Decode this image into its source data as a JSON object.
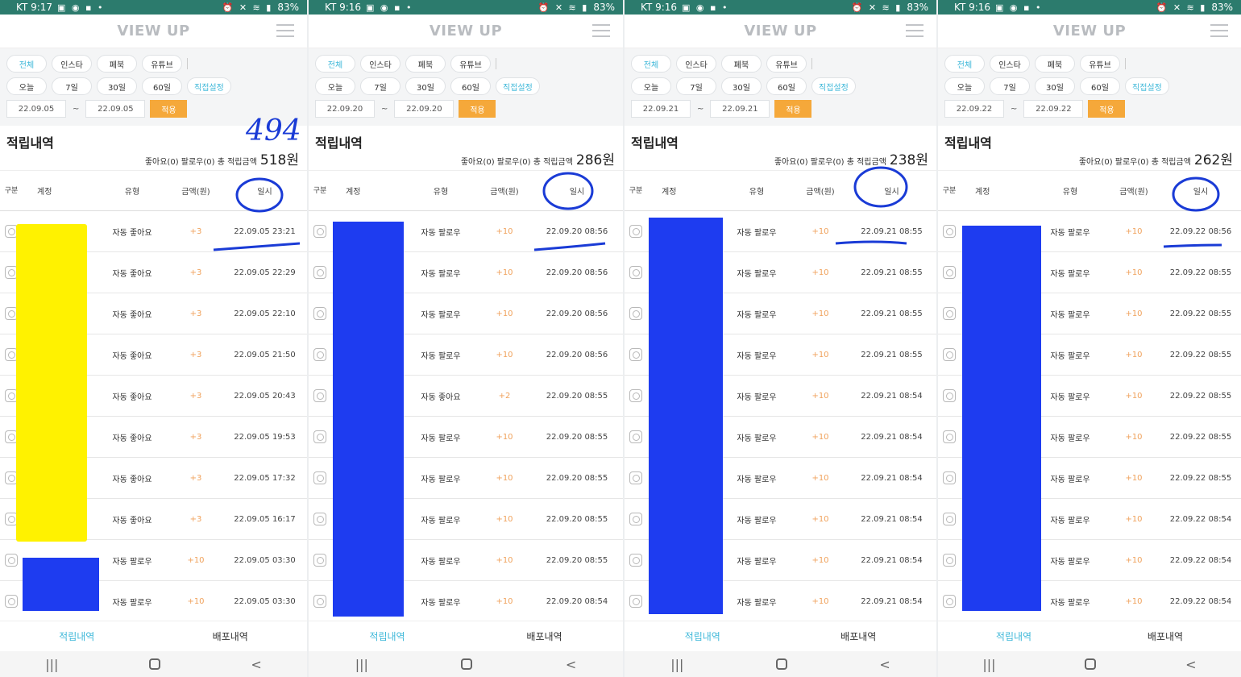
{
  "labels": {
    "logo": "VIEW UP",
    "filter_platforms": [
      "전체",
      "인스타",
      "페북",
      "유튜브"
    ],
    "filter_ranges": [
      "오늘",
      "7일",
      "30일",
      "60일",
      "직접설정"
    ],
    "tilde": "~",
    "apply": "적용",
    "section_title": "적립내역",
    "summary_prefix": "좋아요(0) 팔로우(0) 총 적립금액",
    "headers": [
      "구분",
      "계정",
      "유형",
      "금액(원)",
      "일시"
    ],
    "tabs": [
      "적립내역",
      "배포내역"
    ],
    "nav": [
      "|||",
      "<"
    ]
  },
  "colors": {
    "status_bar": "#2c7b6d",
    "accent_blue": "#3fb8d9",
    "apply_orange": "#f5a83a",
    "amount_orange": "#f0a25c",
    "yellow_redaction": "#fff200",
    "blue_redaction": "#1e3cf0",
    "annotation_ink": "#1a3bd6"
  },
  "icons": {
    "row_icon": "instagram-icon",
    "menu": "hamburger-menu-icon",
    "nav_home": "home-square-icon"
  },
  "screens": [
    {
      "status": {
        "carrier_time": "KT 9:17",
        "battery": "83%"
      },
      "date_from": "22.09.05",
      "date_to": "22.09.05",
      "total": "518원",
      "handwritten_note": "494",
      "rows": [
        {
          "type": "자동 좋아요",
          "amount": "+3",
          "time": "22.09.05 23:21"
        },
        {
          "type": "자동 좋아요",
          "amount": "+3",
          "time": "22.09.05 22:29"
        },
        {
          "type": "자동 좋아요",
          "amount": "+3",
          "time": "22.09.05 22:10"
        },
        {
          "type": "자동 좋아요",
          "amount": "+3",
          "time": "22.09.05 21:50"
        },
        {
          "type": "자동 좋아요",
          "amount": "+3",
          "time": "22.09.05 20:43"
        },
        {
          "type": "자동 좋아요",
          "amount": "+3",
          "time": "22.09.05 19:53"
        },
        {
          "type": "자동 좋아요",
          "amount": "+3",
          "time": "22.09.05 17:32"
        },
        {
          "type": "자동 좋아요",
          "amount": "+3",
          "time": "22.09.05 16:17"
        },
        {
          "type": "자동 팔로우",
          "amount": "+10",
          "time": "22.09.05 03:30"
        },
        {
          "type": "자동 팔로우",
          "amount": "+10",
          "time": "22.09.05 03:30"
        }
      ]
    },
    {
      "status": {
        "carrier_time": "KT 9:16",
        "battery": "83%"
      },
      "date_from": "22.09.20",
      "date_to": "22.09.20",
      "total": "286원",
      "rows": [
        {
          "type": "자동 팔로우",
          "amount": "+10",
          "time": "22.09.20 08:56"
        },
        {
          "type": "자동 팔로우",
          "amount": "+10",
          "time": "22.09.20 08:56"
        },
        {
          "type": "자동 팔로우",
          "amount": "+10",
          "time": "22.09.20 08:56"
        },
        {
          "type": "자동 팔로우",
          "amount": "+10",
          "time": "22.09.20 08:56"
        },
        {
          "type": "자동 좋아요",
          "amount": "+2",
          "time": "22.09.20 08:55"
        },
        {
          "type": "자동 팔로우",
          "amount": "+10",
          "time": "22.09.20 08:55"
        },
        {
          "type": "자동 팔로우",
          "amount": "+10",
          "time": "22.09.20 08:55"
        },
        {
          "type": "자동 팔로우",
          "amount": "+10",
          "time": "22.09.20 08:55"
        },
        {
          "type": "자동 팔로우",
          "amount": "+10",
          "time": "22.09.20 08:55"
        },
        {
          "type": "자동 팔로우",
          "amount": "+10",
          "time": "22.09.20 08:54"
        }
      ]
    },
    {
      "status": {
        "carrier_time": "KT 9:16",
        "battery": "83%"
      },
      "date_from": "22.09.21",
      "date_to": "22.09.21",
      "total": "238원",
      "rows": [
        {
          "type": "자동 팔로우",
          "amount": "+10",
          "time": "22.09.21 08:55"
        },
        {
          "type": "자동 팔로우",
          "amount": "+10",
          "time": "22.09.21 08:55"
        },
        {
          "type": "자동 팔로우",
          "amount": "+10",
          "time": "22.09.21 08:55"
        },
        {
          "type": "자동 팔로우",
          "amount": "+10",
          "time": "22.09.21 08:55"
        },
        {
          "type": "자동 팔로우",
          "amount": "+10",
          "time": "22.09.21 08:54"
        },
        {
          "type": "자동 팔로우",
          "amount": "+10",
          "time": "22.09.21 08:54"
        },
        {
          "type": "자동 팔로우",
          "amount": "+10",
          "time": "22.09.21 08:54"
        },
        {
          "type": "자동 팔로우",
          "amount": "+10",
          "time": "22.09.21 08:54"
        },
        {
          "type": "자동 팔로우",
          "amount": "+10",
          "time": "22.09.21 08:54"
        },
        {
          "type": "자동 팔로우",
          "amount": "+10",
          "time": "22.09.21 08:54"
        }
      ]
    },
    {
      "status": {
        "carrier_time": "KT 9:16",
        "battery": "83%"
      },
      "date_from": "22.09.22",
      "date_to": "22.09.22",
      "total": "262원",
      "rows": [
        {
          "type": "자동 팔로우",
          "amount": "+10",
          "time": "22.09.22 08:56"
        },
        {
          "type": "자동 팔로우",
          "amount": "+10",
          "time": "22.09.22 08:55"
        },
        {
          "type": "자동 팔로우",
          "amount": "+10",
          "time": "22.09.22 08:55"
        },
        {
          "type": "자동 팔로우",
          "amount": "+10",
          "time": "22.09.22 08:55"
        },
        {
          "type": "자동 팔로우",
          "amount": "+10",
          "time": "22.09.22 08:55"
        },
        {
          "type": "자동 팔로우",
          "amount": "+10",
          "time": "22.09.22 08:55"
        },
        {
          "type": "자동 팔로우",
          "amount": "+10",
          "time": "22.09.22 08:55"
        },
        {
          "type": "자동 팔로우",
          "amount": "+10",
          "time": "22.09.22 08:54"
        },
        {
          "type": "자동 팔로우",
          "amount": "+10",
          "time": "22.09.22 08:54"
        },
        {
          "type": "자동 팔로우",
          "amount": "+10",
          "time": "22.09.22 08:54"
        }
      ]
    }
  ]
}
